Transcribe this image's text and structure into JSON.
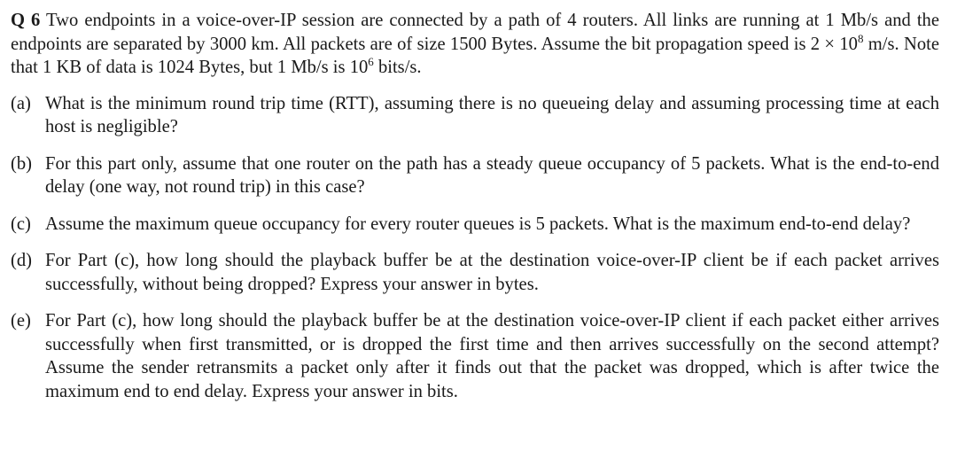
{
  "question": {
    "number": "Q 6",
    "intro_1": " Two endpoints in a voice-over-IP session are connected by a path of 4 routers.  All links are running at 1 Mb/s and the endpoints are separated by 3000 km.  All packets are of size 1500 Bytes.  Assume the bit propagation speed is 2 × 10",
    "intro_exp_1": "8",
    "intro_2": " m/s.  Note that 1 KB of data is 1024 Bytes, but 1 Mb/s is 10",
    "intro_exp_2": "6",
    "intro_3": " bits/s."
  },
  "parts": [
    {
      "label": "(a)",
      "text": "What is the minimum round trip time (RTT), assuming there is no queueing delay and assuming processing time at each host is negligible?"
    },
    {
      "label": "(b)",
      "text": "For this part only, assume that one router on the path has a steady queue occupancy of 5 packets. What is the end-to-end delay (one way, not round trip) in this case?"
    },
    {
      "label": "(c)",
      "text": "Assume the maximum queue occupancy for every router queues is 5 packets.  What is the maximum end-to-end delay?"
    },
    {
      "label": "(d)",
      "text": "For Part (c), how long should the playback buffer be at the destination voice-over-IP client be if each packet arrives successfully, without being dropped? Express your answer in bytes."
    },
    {
      "label": "(e)",
      "text": "For Part (c), how long should the playback buffer be at the destination voice-over-IP client if each packet either arrives successfully when first transmitted, or is dropped the first time and then arrives successfully on the second attempt?  Assume the sender retransmits a packet only after it finds out that the packet was dropped, which is after twice the maximum end to end delay. Express your answer in bits."
    }
  ]
}
